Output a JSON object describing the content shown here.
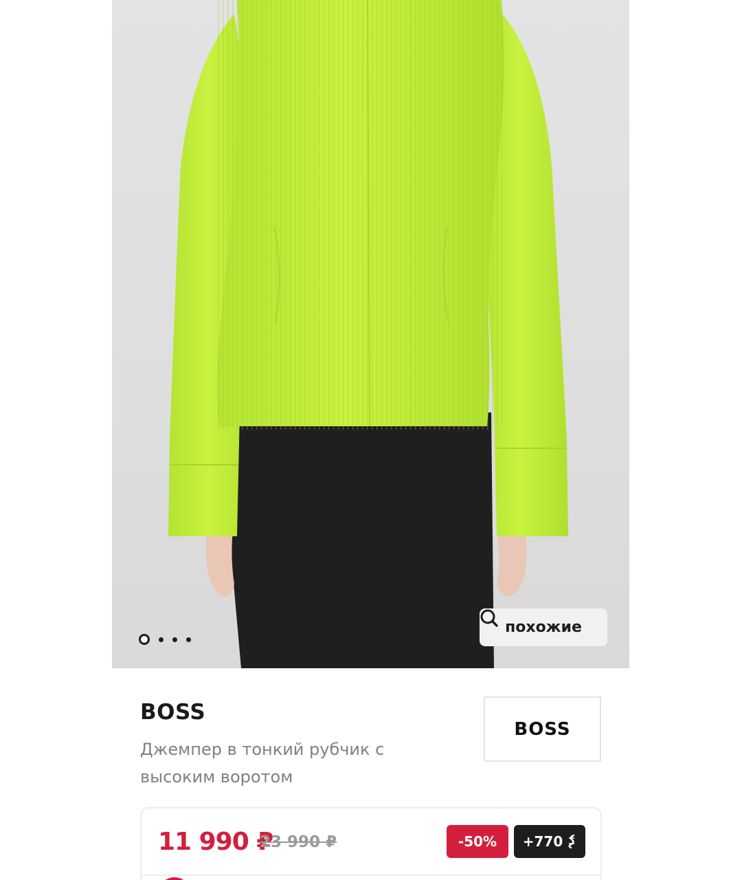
{
  "gallery": {
    "dots_total": 4,
    "active_dot": 0,
    "similar_button": {
      "label": "похожие",
      "icon": "search-icon"
    }
  },
  "product": {
    "brand": "BOSS",
    "title": "Джемпер в тонкий рубчик с высоким воротом",
    "brand_logo_text": "BOSS"
  },
  "price": {
    "current": "11 990 ₽",
    "old": "23 990 ₽",
    "discount": "-50%",
    "bonus": "+770",
    "bonus_icon": "bonus-coin-icon"
  },
  "colors": {
    "accent_red": "#d31f3d",
    "dark": "#1e1e1e",
    "sweater": "#c3f03a"
  }
}
